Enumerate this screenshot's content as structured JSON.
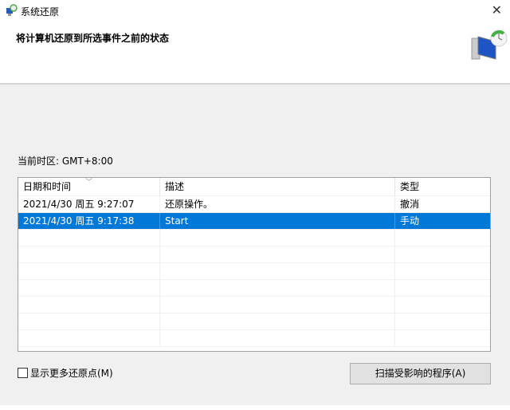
{
  "window": {
    "title": "系统还原",
    "close_label": "✕"
  },
  "header": {
    "subtitle": "将计算机还原到所选事件之前的状态"
  },
  "timezone": "当前时区: GMT+8:00",
  "table": {
    "columns": [
      "日期和时间",
      "描述",
      "类型"
    ],
    "rows": [
      {
        "date": "2021/4/30 周五 9:27:07",
        "desc": "还原操作。",
        "type": "撤消",
        "selected": false
      },
      {
        "date": "2021/4/30 周五 9:17:38",
        "desc": "Start",
        "type": "手动",
        "selected": true
      }
    ]
  },
  "show_more": {
    "label": "显示更多还原点(M)",
    "checked": false
  },
  "scan_button": "扫描受影响的程序(A)",
  "colors": {
    "selection": "#0078d7"
  }
}
